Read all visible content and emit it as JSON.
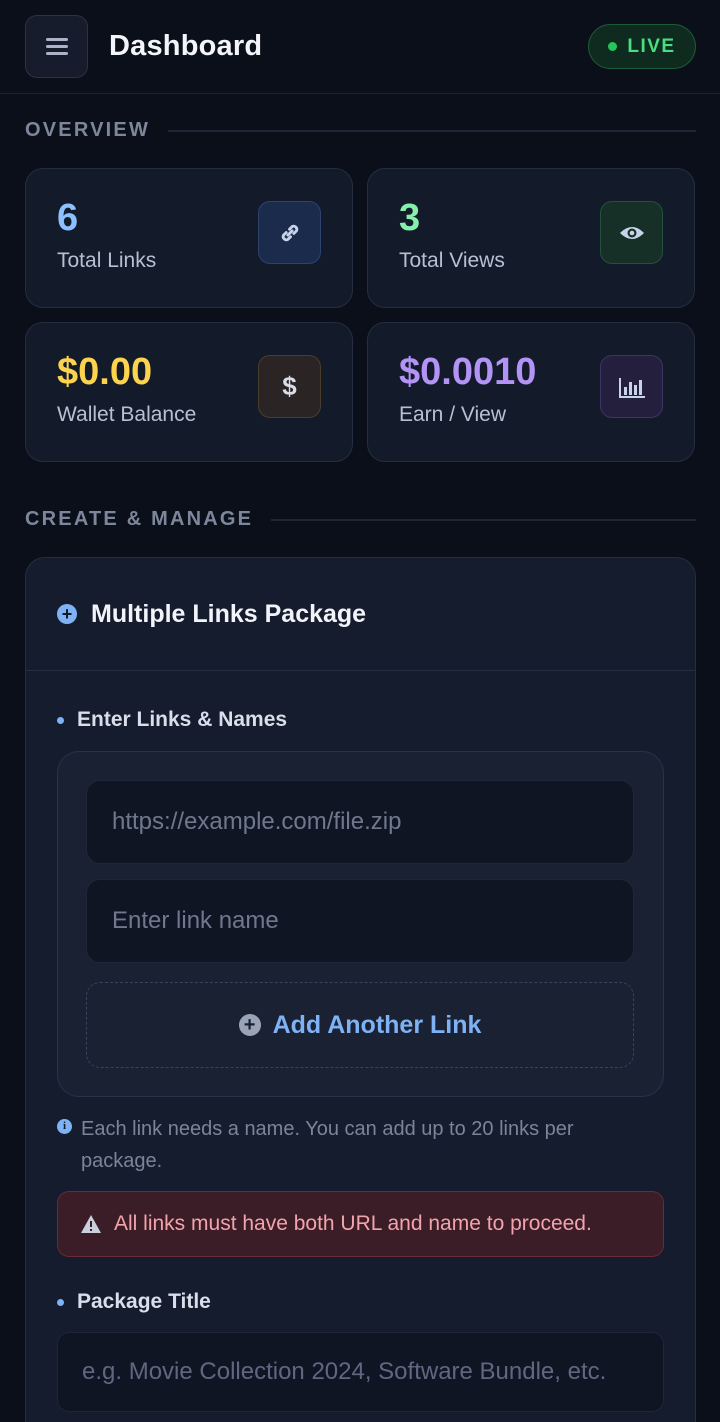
{
  "header": {
    "title": "Dashboard",
    "live_badge": "LIVE"
  },
  "overview": {
    "heading": "OVERVIEW",
    "cards": [
      {
        "value": "6",
        "label": "Total Links",
        "icon": "link-icon",
        "color": "#8cc0ff"
      },
      {
        "value": "3",
        "label": "Total Views",
        "icon": "eye-icon",
        "color": "#86efac"
      },
      {
        "value": "$0.00",
        "label": "Wallet Balance",
        "icon": "dollar-icon",
        "color": "#fcd34d"
      },
      {
        "value": "$0.0010",
        "label": "Earn / View",
        "icon": "bar-chart-icon",
        "color": "#b394f6"
      }
    ]
  },
  "create": {
    "heading": "CREATE & MANAGE",
    "panel_title": "Multiple Links Package",
    "links_label": "Enter Links & Names",
    "url_placeholder": "https://example.com/file.zip",
    "name_placeholder": "Enter link name",
    "add_button": "Add Another Link",
    "hint": "Each link needs a name. You can add up to 20 links per package.",
    "alert": "All links must have both URL and name to proceed.",
    "package_title_label": "Package Title",
    "package_title_placeholder": "e.g. Movie Collection 2024, Software Bundle, etc."
  },
  "colors": {
    "accent": "#7fb2f5",
    "live": "#4ade80",
    "alert_text": "#f4a3ad"
  }
}
